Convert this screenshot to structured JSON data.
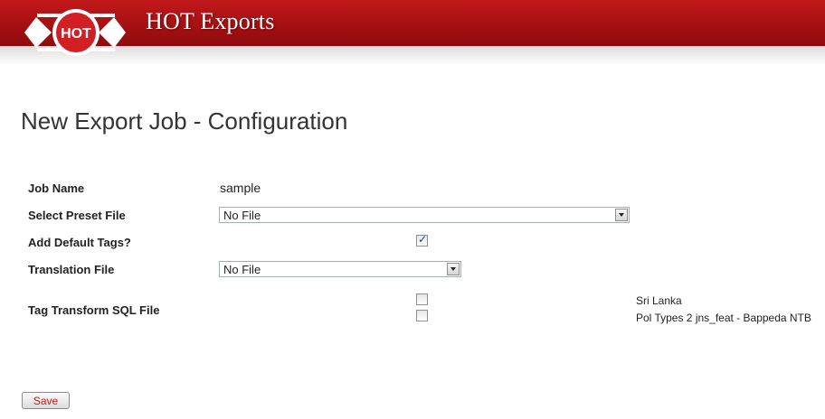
{
  "header": {
    "brand": "HOT Exports",
    "logo_text": "HOT",
    "colors": {
      "header_red": "#a30f12",
      "logo_red": "#d21f26"
    }
  },
  "page": {
    "title": "New Export Job - Configuration"
  },
  "form": {
    "job_name": {
      "label": "Job Name",
      "value": "sample"
    },
    "preset_file": {
      "label": "Select Preset File",
      "selected": "No File"
    },
    "default_tags": {
      "label": "Add Default Tags?",
      "checked": true
    },
    "translation_file": {
      "label": "Translation File",
      "selected": "No File"
    },
    "tag_transform": {
      "label": "Tag Transform SQL File",
      "options": [
        {
          "name": "Sri Lanka",
          "checked": false
        },
        {
          "name": "Pol Types 2 jns_feat - Bappeda NTB",
          "checked": false
        }
      ]
    },
    "save_label": "Save"
  }
}
